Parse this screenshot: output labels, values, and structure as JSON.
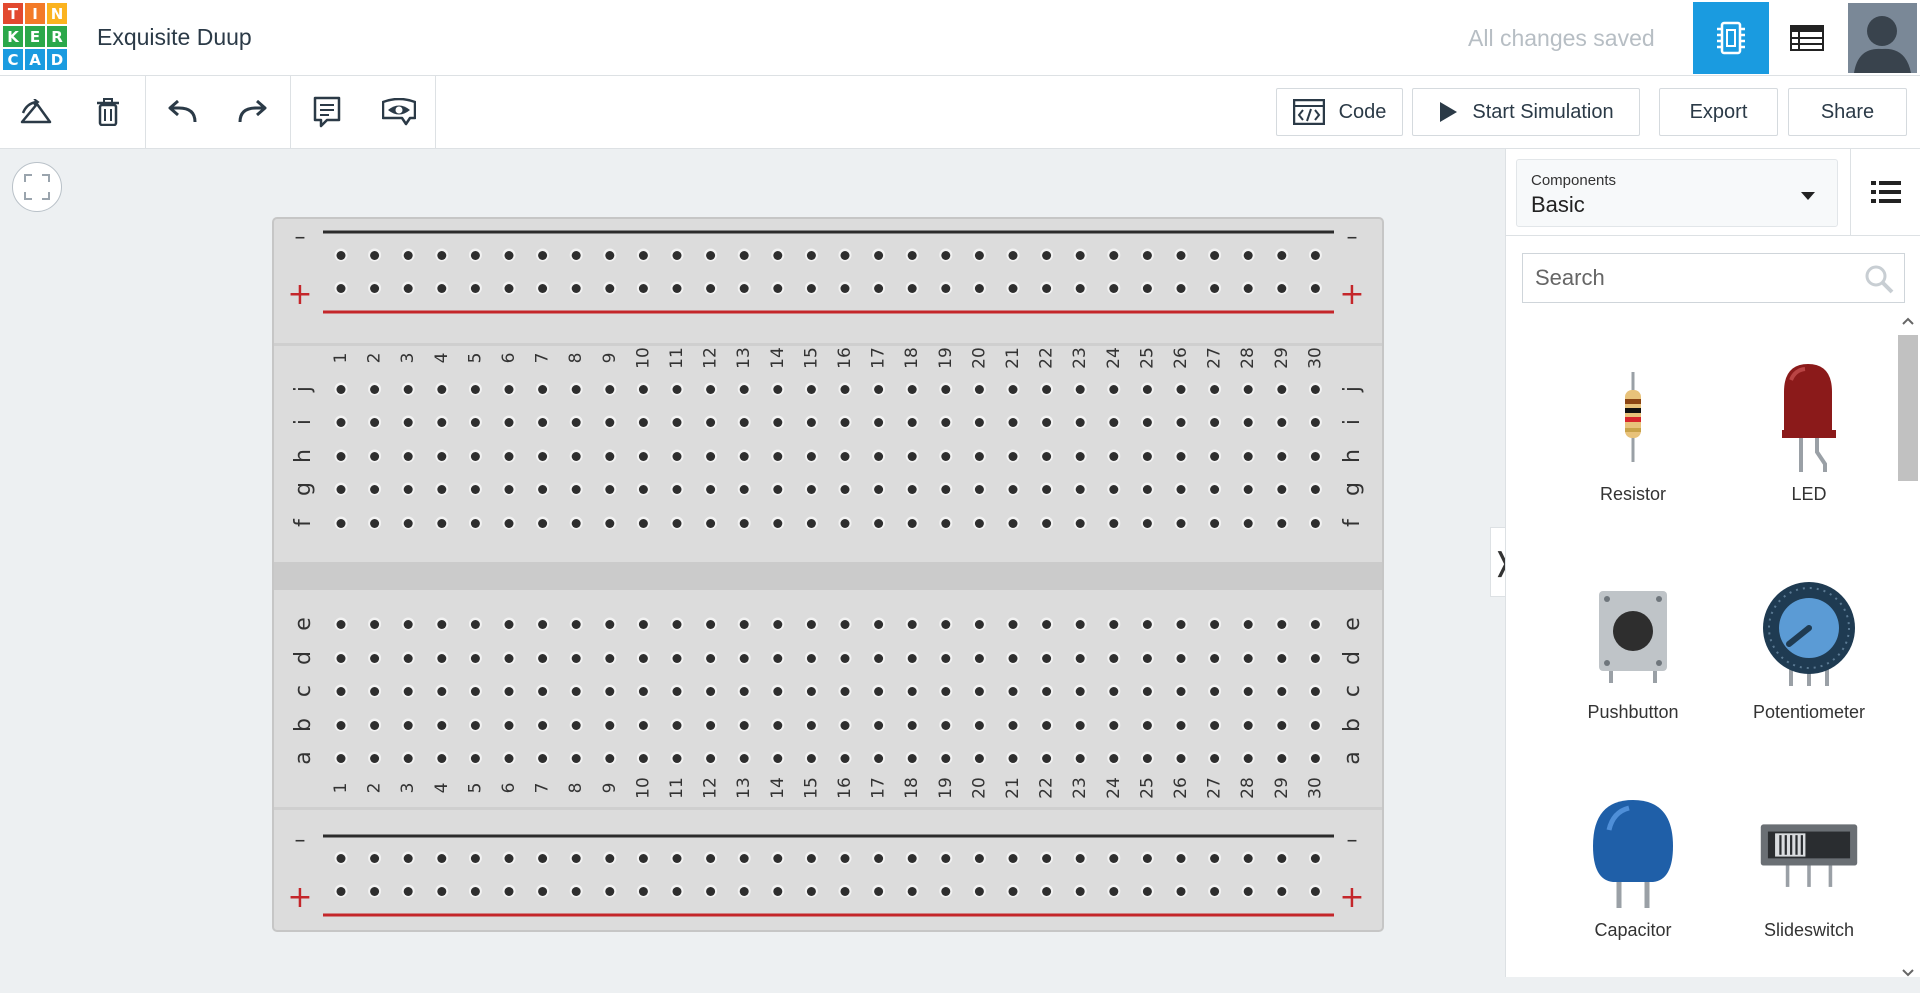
{
  "app": {
    "logo_letters": [
      "T",
      "I",
      "N",
      "K",
      "E",
      "R",
      "C",
      "A",
      "D"
    ],
    "logo_colors": [
      "#e2492f",
      "#f37a28",
      "#fbb31f",
      "#2ba84a",
      "#2ba84a",
      "#2ba84a",
      "#1a9be0",
      "#1a9be0",
      "#1a9be0"
    ],
    "project_title": "Exquisite Duup",
    "save_status": "All changes saved",
    "accent_color": "#1a9be0"
  },
  "topbar": {
    "circuit_view_icon": "breadboard-chip-icon",
    "schematic_view_icon": "schematic-table-icon",
    "avatar_icon": "user-avatar"
  },
  "toolbar": {
    "tools": [
      "rotate-icon",
      "trash-icon",
      "undo-icon",
      "redo-icon",
      "notes-icon",
      "eye-icon"
    ],
    "code_label": "Code",
    "start_simulation_label": "Start Simulation",
    "export_label": "Export",
    "share_label": "Share"
  },
  "breadboard": {
    "columns": [
      "1",
      "2",
      "3",
      "4",
      "5",
      "6",
      "7",
      "8",
      "9",
      "10",
      "11",
      "12",
      "13",
      "14",
      "15",
      "16",
      "17",
      "18",
      "19",
      "20",
      "21",
      "22",
      "23",
      "24",
      "25",
      "26",
      "27",
      "28",
      "29",
      "30"
    ],
    "top_rows": [
      "j",
      "i",
      "h",
      "g",
      "f"
    ],
    "bottom_rows": [
      "e",
      "d",
      "c",
      "b",
      "a"
    ],
    "rail_minus": "—",
    "rail_plus": "+",
    "rail_red": "#c4262a",
    "rail_black": "#2b2b2b"
  },
  "panel": {
    "components_label": "Components",
    "components_value": "Basic",
    "search_placeholder": "Search",
    "items": [
      {
        "name": "Resistor",
        "icon": "resistor-icon"
      },
      {
        "name": "LED",
        "icon": "led-icon"
      },
      {
        "name": "Pushbutton",
        "icon": "pushbutton-icon"
      },
      {
        "name": "Potentiometer",
        "icon": "potentiometer-icon"
      },
      {
        "name": "Capacitor",
        "icon": "capacitor-icon"
      },
      {
        "name": "Slideswitch",
        "icon": "slideswitch-icon"
      }
    ]
  }
}
